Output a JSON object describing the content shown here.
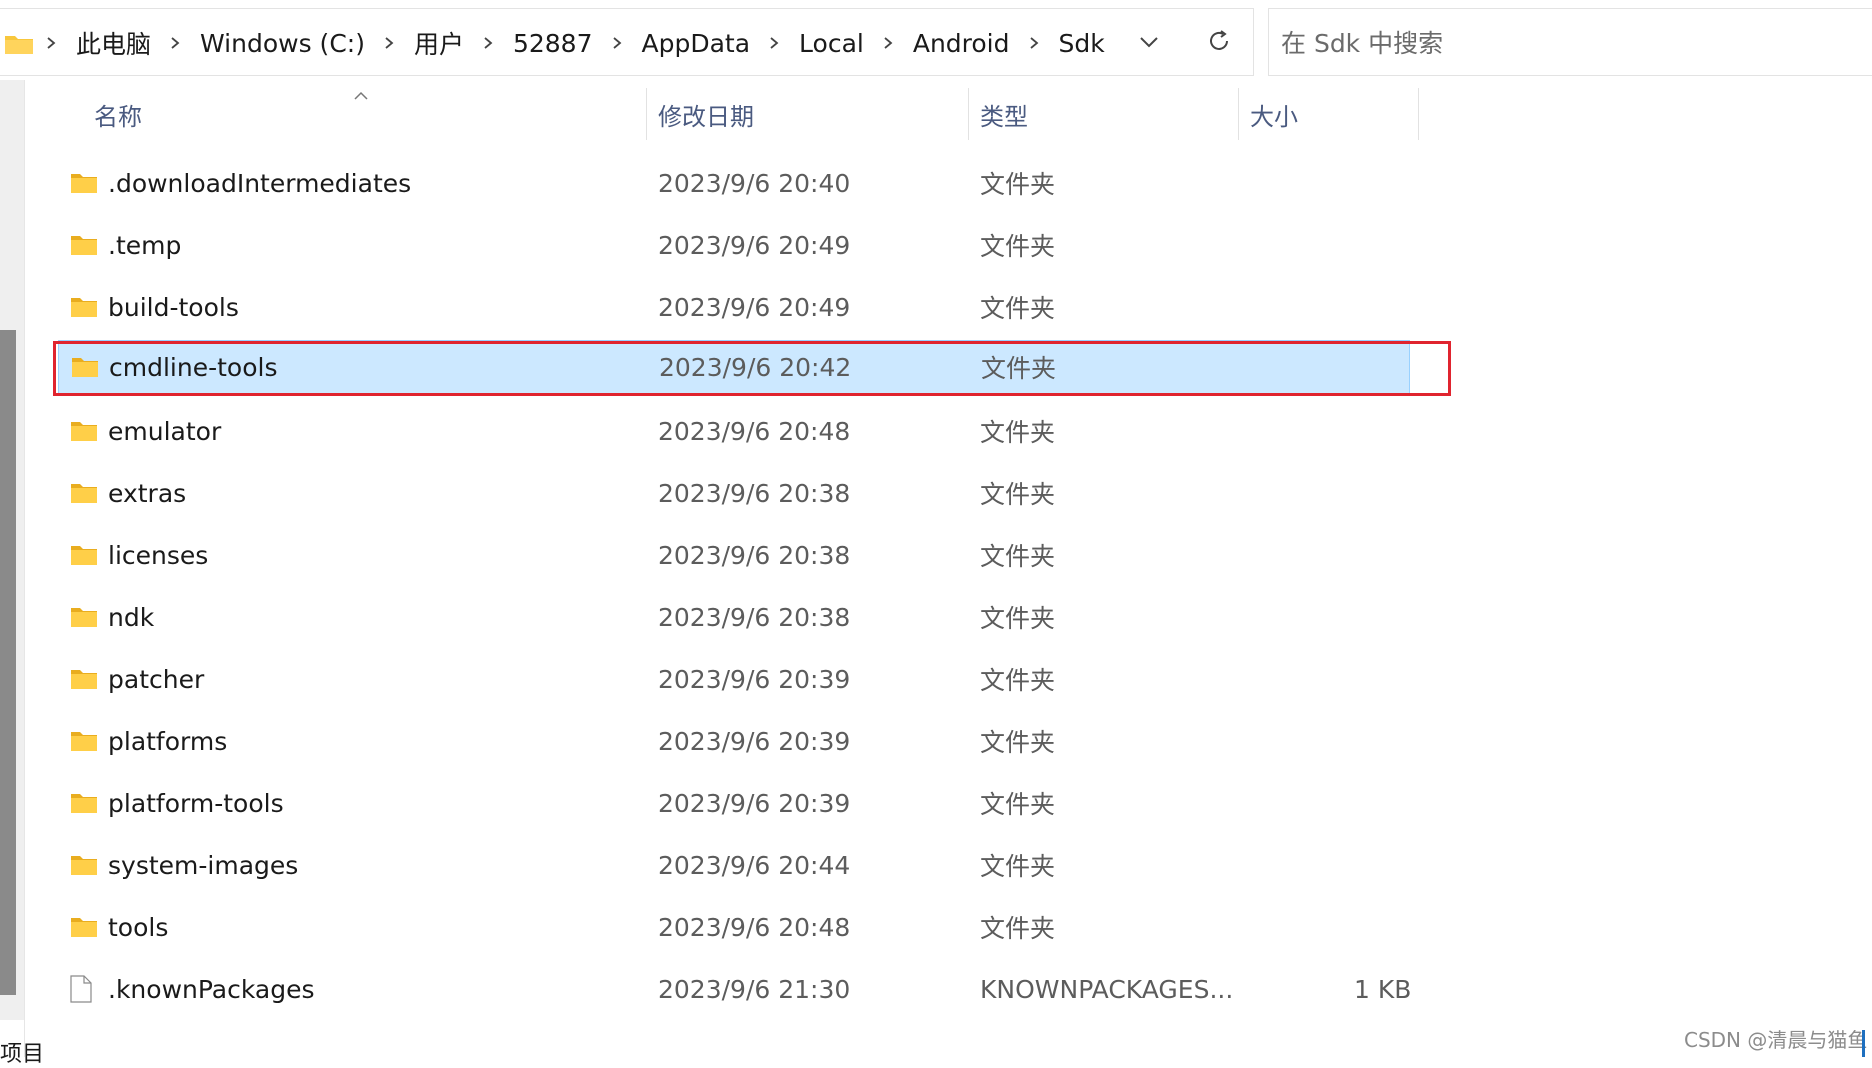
{
  "address_bar": {
    "breadcrumbs": [
      "此电脑",
      "Windows (C:)",
      "用户",
      "52887",
      "AppData",
      "Local",
      "Android",
      "Sdk"
    ]
  },
  "search": {
    "placeholder": "在 Sdk 中搜索"
  },
  "columns": {
    "name": "名称",
    "date": "修改日期",
    "type": "类型",
    "size": "大小"
  },
  "files": [
    {
      "name": ".downloadIntermediates",
      "date": "2023/9/6 20:40",
      "type": "文件夹",
      "size": "",
      "kind": "folder"
    },
    {
      "name": ".temp",
      "date": "2023/9/6 20:49",
      "type": "文件夹",
      "size": "",
      "kind": "folder"
    },
    {
      "name": "build-tools",
      "date": "2023/9/6 20:49",
      "type": "文件夹",
      "size": "",
      "kind": "folder"
    },
    {
      "name": "cmdline-tools",
      "date": "2023/9/6 20:42",
      "type": "文件夹",
      "size": "",
      "kind": "folder",
      "selected": true,
      "highlighted": true
    },
    {
      "name": "emulator",
      "date": "2023/9/6 20:48",
      "type": "文件夹",
      "size": "",
      "kind": "folder"
    },
    {
      "name": "extras",
      "date": "2023/9/6 20:38",
      "type": "文件夹",
      "size": "",
      "kind": "folder"
    },
    {
      "name": "licenses",
      "date": "2023/9/6 20:38",
      "type": "文件夹",
      "size": "",
      "kind": "folder"
    },
    {
      "name": "ndk",
      "date": "2023/9/6 20:38",
      "type": "文件夹",
      "size": "",
      "kind": "folder"
    },
    {
      "name": "patcher",
      "date": "2023/9/6 20:39",
      "type": "文件夹",
      "size": "",
      "kind": "folder"
    },
    {
      "name": "platforms",
      "date": "2023/9/6 20:39",
      "type": "文件夹",
      "size": "",
      "kind": "folder"
    },
    {
      "name": "platform-tools",
      "date": "2023/9/6 20:39",
      "type": "文件夹",
      "size": "",
      "kind": "folder"
    },
    {
      "name": "system-images",
      "date": "2023/9/6 20:44",
      "type": "文件夹",
      "size": "",
      "kind": "folder"
    },
    {
      "name": "tools",
      "date": "2023/9/6 20:48",
      "type": "文件夹",
      "size": "",
      "kind": "folder"
    },
    {
      "name": ".knownPackages",
      "date": "2023/9/6 21:30",
      "type": "KNOWNPACKAGES...",
      "size": "1 KB",
      "kind": "file"
    }
  ],
  "status_bar": {
    "text": "项目"
  },
  "watermark": "CSDN @清晨与猫鱼",
  "colors": {
    "selection_bg": "#cce8ff",
    "selection_border": "#99d1ff",
    "highlight_box": "#e0242f",
    "folder_yellow": "#f8c73c",
    "header_text": "#4a5a80"
  }
}
